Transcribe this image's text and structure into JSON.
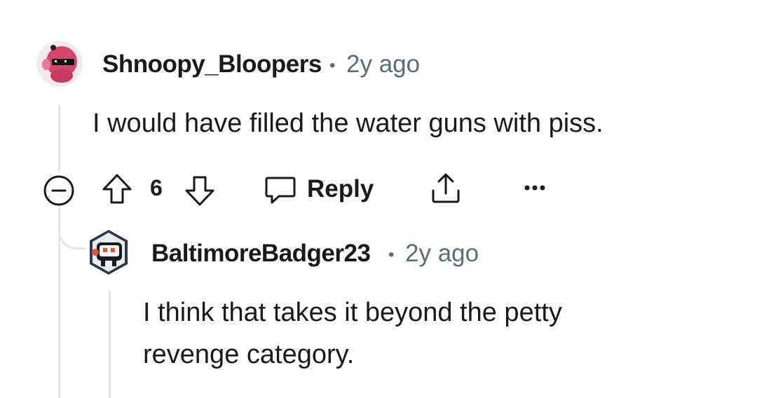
{
  "comment": {
    "username": "Shnoopy_Bloopers",
    "separator": "•",
    "age": "2y ago",
    "body": "I would have filled the water guns with piss.",
    "votes": "6",
    "reply_label": "Reply",
    "icons": [
      "collapse-icon",
      "upvote-icon",
      "downvote-icon",
      "reply-icon",
      "share-icon",
      "more-icon"
    ]
  },
  "reply": {
    "username": "BaltimoreBadger23",
    "separator": "•",
    "age": "2y ago",
    "body_line1": "I think that takes it beyond the petty",
    "body_line2": "revenge category."
  },
  "colors": {
    "text": "#1a1a1b",
    "meta": "#576f76",
    "thread_line": "#e5e5e5",
    "avatar1_bg": "#d9446b",
    "avatar2_bg": "#2a3a4a"
  }
}
